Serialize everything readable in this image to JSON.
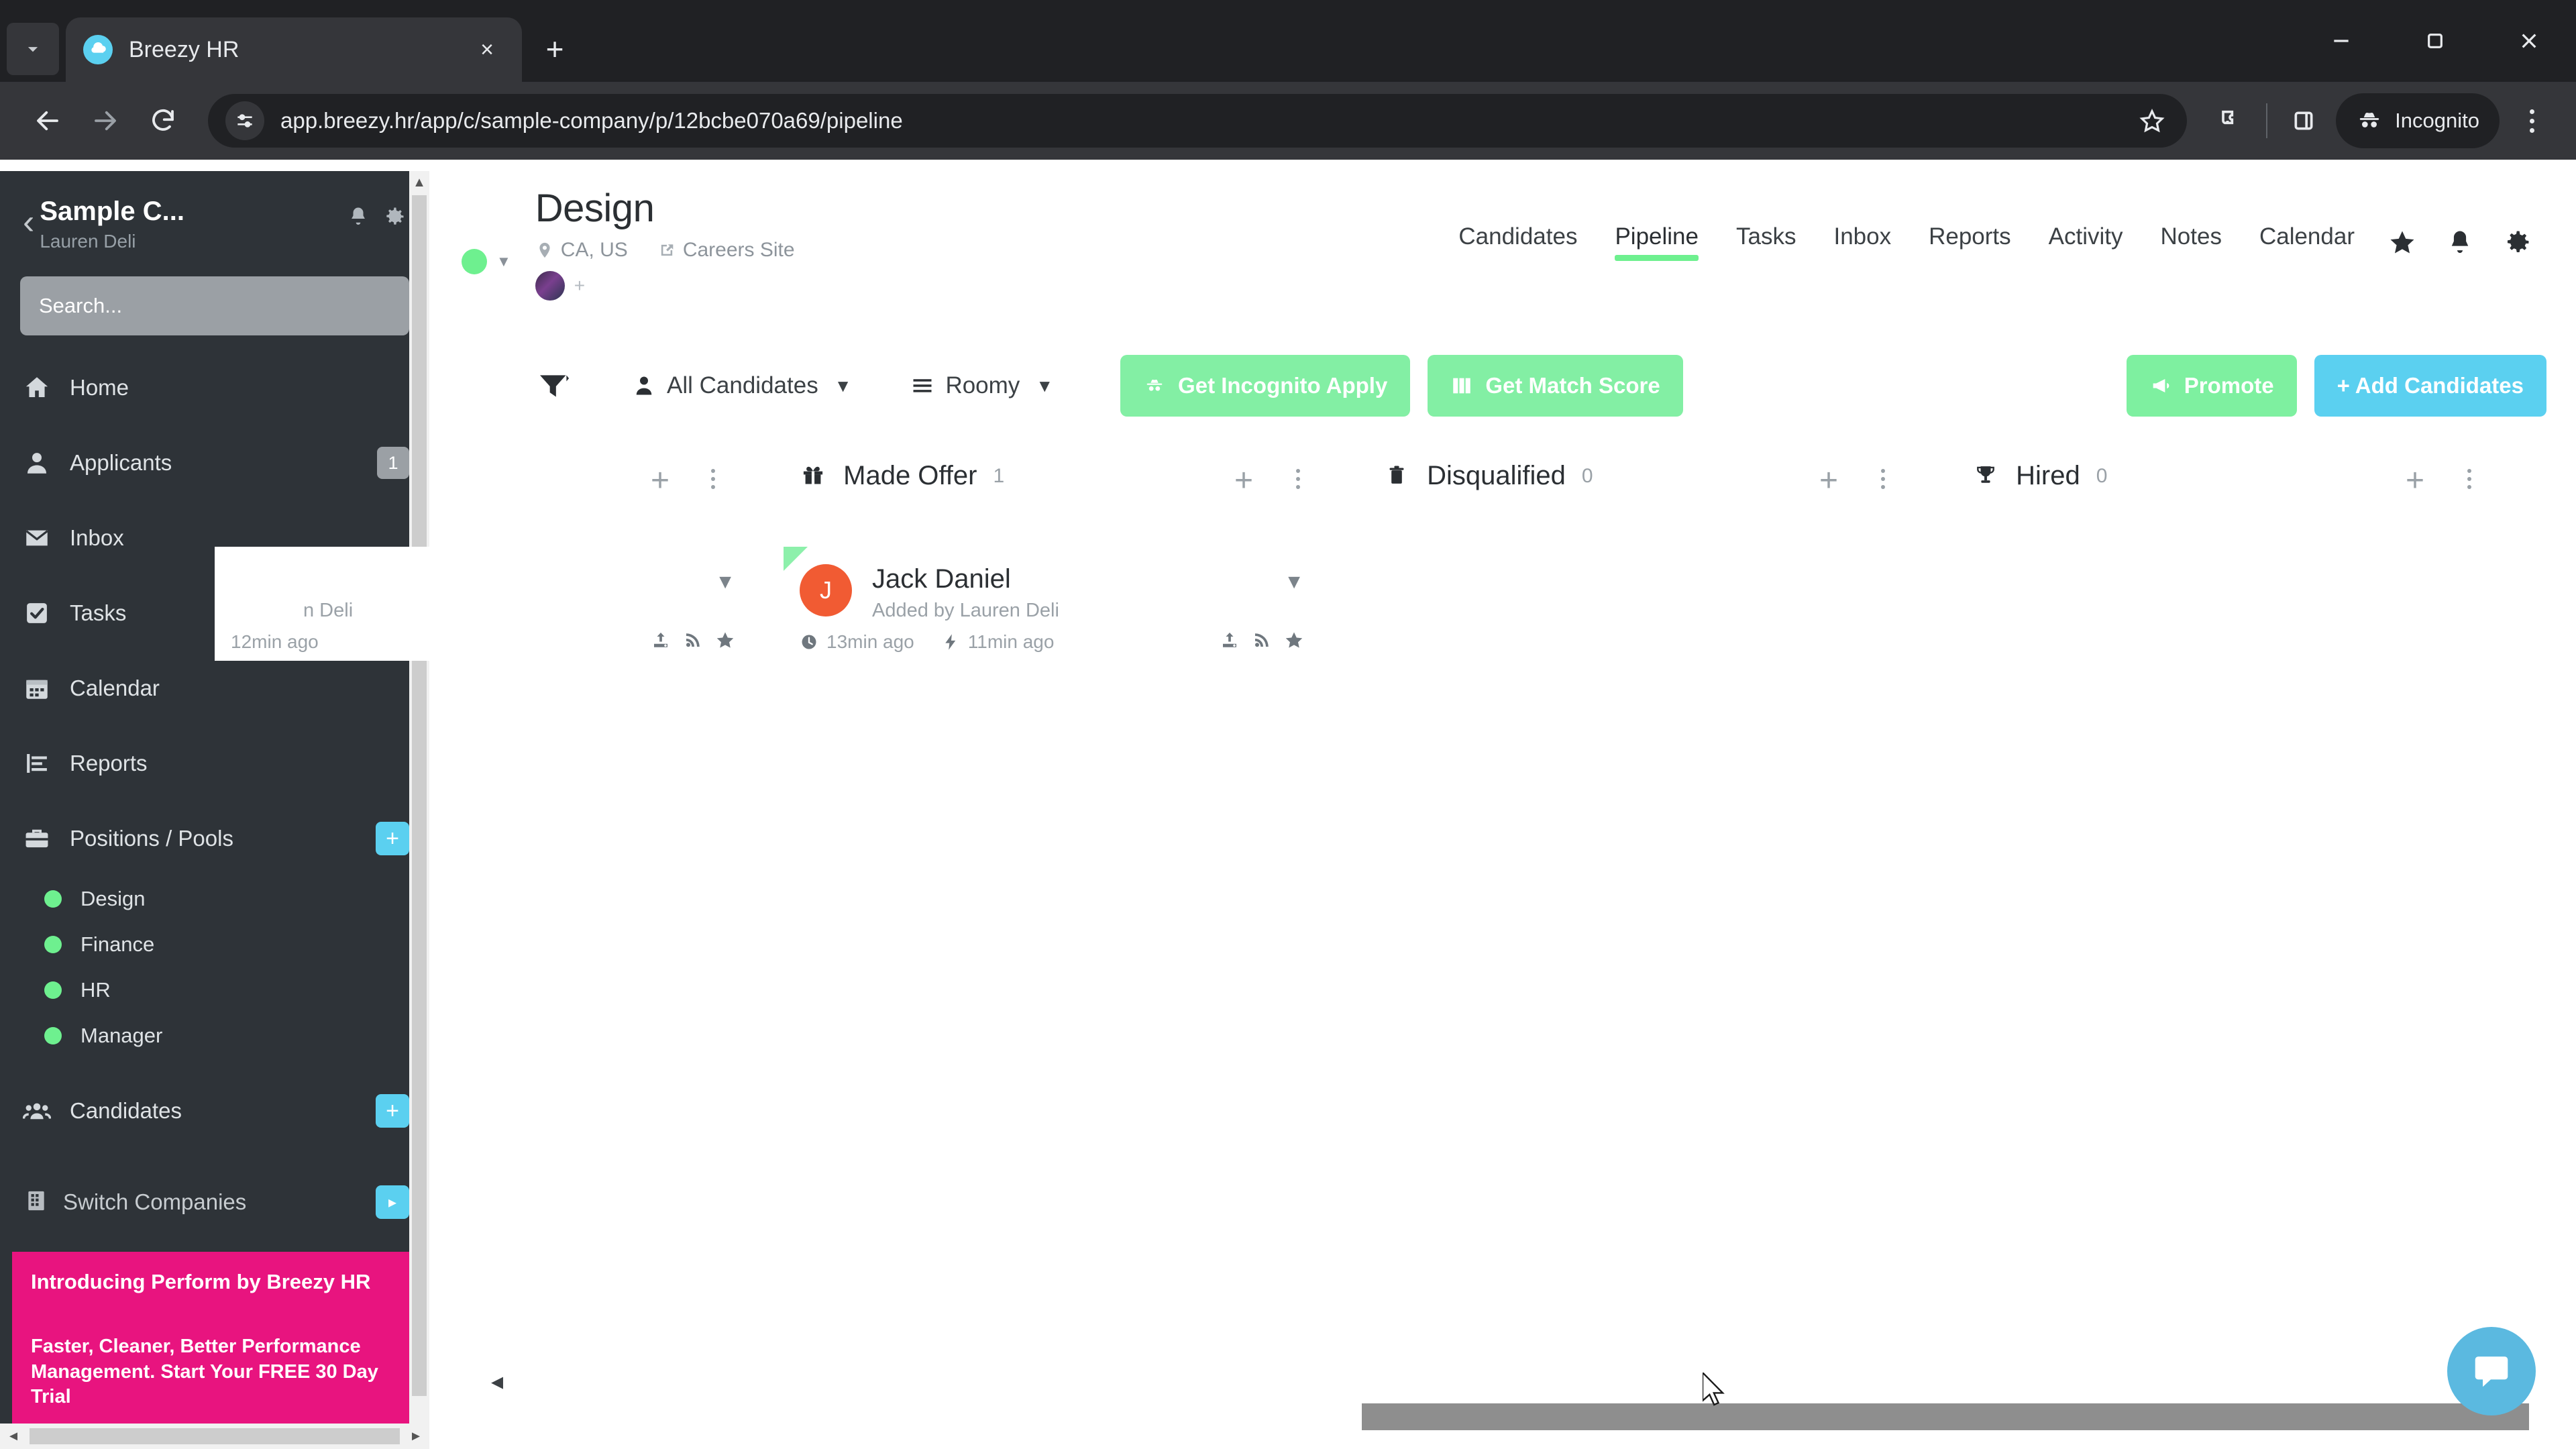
{
  "browser": {
    "tab": {
      "title": "Breezy HR",
      "favicon": "breezy-cloud-icon",
      "close": "×"
    },
    "newtab_label": "+",
    "url": "app.breezy.hr/app/c/sample-company/p/12bcbe070a69/pipeline",
    "profile_label": "Incognito",
    "window": {
      "minimize": "minimize",
      "maximize": "maximize",
      "close": "close"
    }
  },
  "sidebar": {
    "back_caret": "‹",
    "company": "Sample C...",
    "user": "Lauren Deli",
    "search_placeholder": "Search...",
    "items": [
      {
        "label": "Home",
        "icon": "home-icon",
        "badge": null
      },
      {
        "label": "Applicants",
        "icon": "person-icon",
        "badge": "1"
      },
      {
        "label": "Inbox",
        "icon": "envelope-icon",
        "badge": null
      },
      {
        "label": "Tasks",
        "icon": "checkbox-icon",
        "badge": "+"
      },
      {
        "label": "Calendar",
        "icon": "calendar-icon",
        "badge": null
      },
      {
        "label": "Reports",
        "icon": "bar-chart-icon",
        "badge": null
      }
    ],
    "positions_label": "Positions / Pools",
    "positions_badge": "+",
    "pools": [
      {
        "label": "Design",
        "color": "#6ef08f"
      },
      {
        "label": "Finance",
        "color": "#6ef08f"
      },
      {
        "label": "HR",
        "color": "#6ef08f"
      },
      {
        "label": "Manager",
        "color": "#6ef08f"
      }
    ],
    "candidates_label": "Candidates",
    "candidates_badge": "+",
    "switch_companies_label": "Switch Companies",
    "switch_arrow": "▸",
    "promo": {
      "title": "Introducing Perform by Breezy HR",
      "body": "Faster, Cleaner, Better Performance Management. Start Your FREE 30 Day Trial",
      "color": "#e8147f"
    }
  },
  "position": {
    "title": "Design",
    "status_color": "#6ef08f",
    "location": "CA, US",
    "careers_site": "Careers Site",
    "avatar_add": "+"
  },
  "topnav": {
    "items": [
      {
        "label": "Candidates",
        "active": false
      },
      {
        "label": "Pipeline",
        "active": true
      },
      {
        "label": "Tasks",
        "active": false
      },
      {
        "label": "Inbox",
        "active": false
      },
      {
        "label": "Reports",
        "active": false
      },
      {
        "label": "Activity",
        "active": false
      },
      {
        "label": "Notes",
        "active": false
      },
      {
        "label": "Calendar",
        "active": false
      }
    ],
    "icons": [
      "star-icon",
      "bell-icon",
      "gear-icon"
    ],
    "active_underline_color": "#6ef08f"
  },
  "toolbar": {
    "filter_icon": "funnel-icon",
    "candidates_filter": "All Candidates",
    "density_filter": "Roomy",
    "caret": "⌄",
    "incognito_apply": "Get Incognito Apply",
    "match_score": "Get Match Score",
    "promote": "Promote",
    "add_candidates": "+ Add Candidates",
    "colors": {
      "green": "#83efa4",
      "blue": "#5bd0f0"
    }
  },
  "board": {
    "columns": [
      {
        "title": "Made Offer",
        "count": "1",
        "icon": "gift-icon"
      },
      {
        "title": "Disqualified",
        "count": "0",
        "icon": "trash-icon"
      },
      {
        "title": "Hired",
        "count": "0",
        "icon": "trophy-icon"
      }
    ],
    "add_symbol": "+",
    "cards": [
      {
        "name": "Jack Daniel",
        "initial": "J",
        "subtitle": "Added by Lauren Deli",
        "added_time": "13min ago",
        "activity_time": "11min ago",
        "avatar_color": "#f15b33",
        "flag_color": "#8df0ab"
      }
    ],
    "partial_card": {
      "subtitle_fragment": "n Deli",
      "activity_time": "12min ago"
    },
    "left_arrow": "◂"
  },
  "chat": {
    "icon": "chat-bubble-icon",
    "color": "#5bb9e0"
  }
}
